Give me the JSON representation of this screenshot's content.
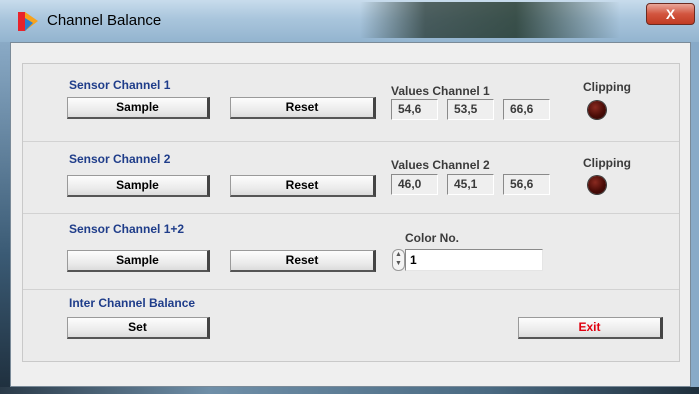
{
  "window": {
    "title": "Channel Balance",
    "close_label": "X"
  },
  "sections": {
    "ch1": {
      "title": "Sensor Channel 1",
      "sample_label": "Sample",
      "reset_label": "Reset",
      "values_label": "Values Channel 1",
      "values": [
        "54,6",
        "53,5",
        "66,6"
      ],
      "clipping_label": "Clipping"
    },
    "ch2": {
      "title": "Sensor Channel 2",
      "sample_label": "Sample",
      "reset_label": "Reset",
      "values_label": "Values Channel 2",
      "values": [
        "46,0",
        "45,1",
        "56,6"
      ],
      "clipping_label": "Clipping"
    },
    "ch12": {
      "title": "Sensor Channel 1+2",
      "sample_label": "Sample",
      "reset_label": "Reset",
      "color_label": "Color No.",
      "color_value": "1"
    },
    "balance": {
      "title": "Inter Channel Balance",
      "set_label": "Set",
      "exit_label": "Exit"
    }
  },
  "colors": {
    "title_text": "#1f3d8a",
    "exit_text": "#e0000f",
    "led_off": "#4a0c07"
  }
}
